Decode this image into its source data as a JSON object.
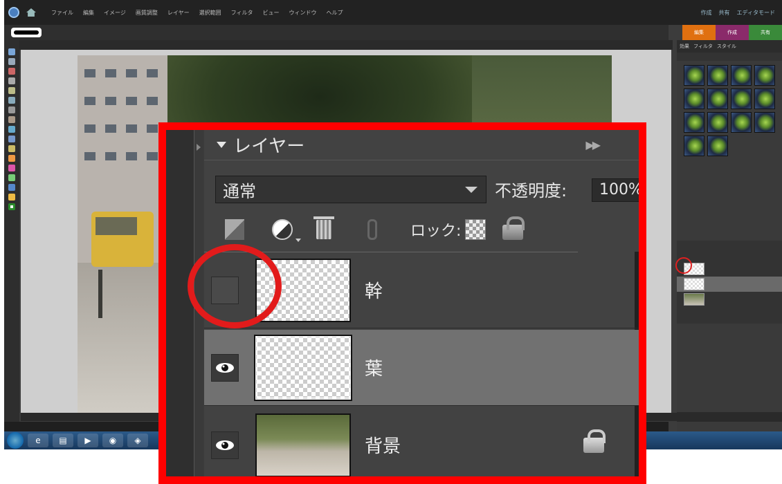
{
  "menubar": {
    "items": [
      "ファイル",
      "編集",
      "イメージ",
      "画質調整",
      "レイヤー",
      "選択範囲",
      "フィルタ",
      "ビュー",
      "ウィンドウ",
      "ヘルプ"
    ],
    "right": [
      "作成",
      "共有",
      "エディタモード"
    ]
  },
  "mode_tabs": [
    {
      "label": "編集",
      "color": "#e07010"
    },
    {
      "label": "作成",
      "color": "#8a2a6a"
    },
    {
      "label": "共有",
      "color": "#3a8a3a"
    }
  ],
  "callout": {
    "panel_title": "レイヤー",
    "blend_mode": "通常",
    "opacity_label": "不透明度:",
    "opacity_value": "100%",
    "lock_label": "ロック:",
    "layers": [
      {
        "name": "幹",
        "visible": false,
        "selected": false,
        "locked": false,
        "thumb": "transparent"
      },
      {
        "name": "葉",
        "visible": true,
        "selected": true,
        "locked": false,
        "thumb": "transparent"
      },
      {
        "name": "背景",
        "visible": true,
        "selected": false,
        "locked": true,
        "thumb": "photo"
      }
    ]
  },
  "right_panel": {
    "tabs": [
      "効果",
      "フィルタ",
      "スタイル"
    ]
  },
  "colors": {
    "callout_border": "#ff0000",
    "highlight_circle": "#e21b1b"
  }
}
